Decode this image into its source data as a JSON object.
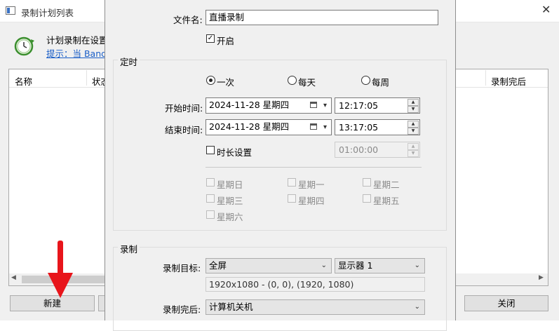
{
  "bg_window": {
    "title": "录制计划列表",
    "info_text": "计划录制在设置",
    "info_link": "提示：当 Bandi",
    "columns": [
      "名称",
      "状态",
      "录制完后"
    ],
    "new_button": "新建",
    "close_button": "关闭"
  },
  "dialog": {
    "filename_label": "文件名:",
    "filename_value": "直播录制",
    "enable_label": "开启",
    "schedule": {
      "group_label": "定时",
      "frequency": [
        "一次",
        "每天",
        "每周"
      ],
      "selected_frequency": "一次",
      "start_label": "开始时间:",
      "start_date": "2024-11-28 星期四",
      "start_time": "12:17:05",
      "end_label": "结束时间:",
      "end_date": "2024-11-28 星期四",
      "end_time": "13:17:05",
      "duration_label": "时长设置",
      "duration_value": "01:00:00",
      "weekdays": [
        "星期日",
        "星期一",
        "星期二",
        "星期三",
        "星期四",
        "星期五",
        "星期六"
      ]
    },
    "record": {
      "group_label": "录制",
      "target_label": "录制目标:",
      "target_value": "全屏",
      "monitor_value": "显示器 1",
      "resolution_text": "1920x1080 - (0, 0), (1920, 1080)",
      "after_label": "录制完后:",
      "after_value": "计算机关机"
    }
  },
  "annotation": {
    "arrow_color": "#e8151b"
  }
}
